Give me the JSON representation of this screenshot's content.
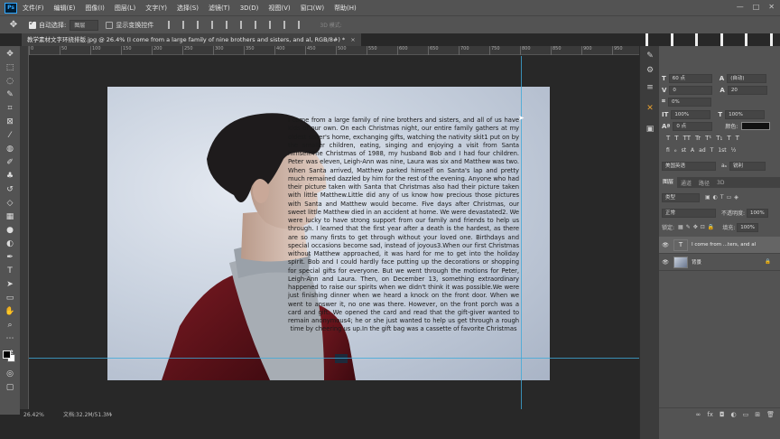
{
  "menubar": {
    "logo": "Ps",
    "items": [
      "文件(F)",
      "编辑(E)",
      "图像(I)",
      "图层(L)",
      "文字(Y)",
      "选择(S)",
      "滤镜(T)",
      "3D(D)",
      "视图(V)",
      "窗口(W)",
      "帮助(H)"
    ],
    "window_controls": [
      "—",
      "□",
      "✕"
    ]
  },
  "optbar": {
    "auto_select_label": "自动选择:",
    "auto_select_value": "图层",
    "show_transform_label": "显示变换控件",
    "mode3d_label": "3D 模式:"
  },
  "tab": {
    "title": "教学素材文字环绕排版.jpg @ 26.4% (I come from a large family of nine brothers and sisters, and al, RGB/8#) *",
    "close": "×"
  },
  "ruler": {
    "ticks": [
      "0",
      "50",
      "100",
      "150",
      "200",
      "250",
      "300",
      "350",
      "400",
      "450",
      "500",
      "550",
      "600",
      "650",
      "700",
      "750",
      "800",
      "850",
      "900",
      "950"
    ]
  },
  "document": {
    "body_text": "I come from a large family of nine brothers and sisters, and all of us have kids of our own. On each Christmas night, our entire family gathers at my oldest sister's home, exchanging gifts, watching the nativity skit1 put on by the smaller children, eating, singing and enjoying a visit from Santa himself.The Christmas of 1988, my husband Bob and I had four children. Peter was eleven, Leigh-Ann was nine, Laura was six and Matthew was two. When Santa arrived, Matthew parked himself on Santa's lap and pretty much remained dazzled by him for the rest of the evening. Anyone who had their picture taken with Santa that Christmas also had their picture taken with little Matthew.Little did any of us know how precious those pictures with Santa and Matthew would become. Five days after Christmas, our sweet little Matthew died in an accident at home. We were devastated2. We were lucky to have strong support from our family and friends to help us through. I learned that the first year after a death is the hardest, as there are so many firsts to get through without your loved one. Birthdays and special occasions become sad, instead of joyous3.When our first Christmas without Matthew approached, it was hard for me to get into the holiday spirit. Bob and I could hardly face putting up the decorations or shopping for special gifts for everyone. But we went through the motions for Peter, Leigh-Ann and Laura. Then, on December 13, something extraordinary happened to raise our spirits when we didn't think it was possible.We were just finishing dinner when we heard a knock on the front door. When we went to answer it, no one was there. However, on the front porch was a card and gift. We opened the card and read that the gift-giver wanted to remain anonymous4; he or she just wanted to help us get through a rough time by cheering us up.In the gift bag was a cassette of favorite Christmas"
  },
  "status": {
    "zoom": "26.42%",
    "doc_info": "文档:32.2M/51.3M",
    "arrow": "›"
  },
  "character": {
    "font_size": "60 点",
    "leading": "(自动)",
    "kerning": "0",
    "tracking": "20",
    "scale_pct": "0%",
    "vscale": "100%",
    "hscale": "100%",
    "baseline": "0 点",
    "color_label": "颜色:",
    "format_buttons": [
      "T",
      "T",
      "TT",
      "Tr",
      "T¹",
      "T₁",
      "T",
      "T"
    ],
    "extra_buttons": [
      "fi",
      "ℴ",
      "st",
      "A",
      "ad",
      "T",
      "1st",
      "½"
    ],
    "language": "美国英语",
    "antialias": "锐利",
    "aa_prefix": "aₐ"
  },
  "layers_panel": {
    "tabs": [
      "图层",
      "通道",
      "路径",
      "3D"
    ],
    "kind_filter": "类型",
    "blend_mode": "正常",
    "opacity_label": "不透明度:",
    "opacity_value": "100%",
    "lock_label": "锁定:",
    "fill_label": "填充:",
    "fill_value": "100%",
    "layers": [
      {
        "name": "I come from ...ters, and al",
        "thumb": "T"
      },
      {
        "name": "背景",
        "thumb": ""
      }
    ],
    "footer_icons": [
      "∞",
      "fx",
      "◘",
      "◐",
      "▭",
      "⊞",
      "🗑"
    ]
  },
  "colors": {
    "accent": "#31a8ff",
    "guide": "#3fa9d8",
    "panel": "#535353"
  }
}
